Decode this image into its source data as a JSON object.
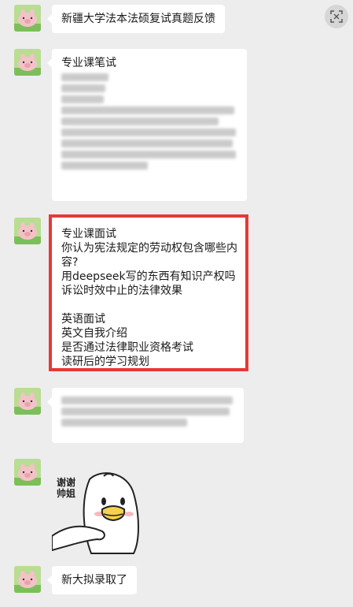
{
  "messages": [
    {
      "text": "新疆大学法本法硕复试真题反馈"
    },
    {
      "title": "专业课笔试"
    },
    {
      "lines": [
        "专业课面试",
        "你认为宪法规定的劳动权包含哪些内",
        "容?",
        "用deepseek写的东西有知识产权吗",
        "诉讼时效中止的法律效果",
        "",
        "英语面试",
        "英文自我介绍",
        "是否通过法律职业资格考试",
        "读研后的学习规划"
      ]
    },
    {
      "sticker_text": [
        "谢谢",
        "帅姐"
      ]
    },
    {
      "text": "新大拟录取了"
    }
  ],
  "colors": {
    "background": "#ededed",
    "bubble": "#ffffff",
    "highlight_border": "#e53935"
  },
  "icons": {
    "avatar": "pig-avatar-icon",
    "scan": "scan-icon",
    "sticker": "duck-sticker"
  }
}
